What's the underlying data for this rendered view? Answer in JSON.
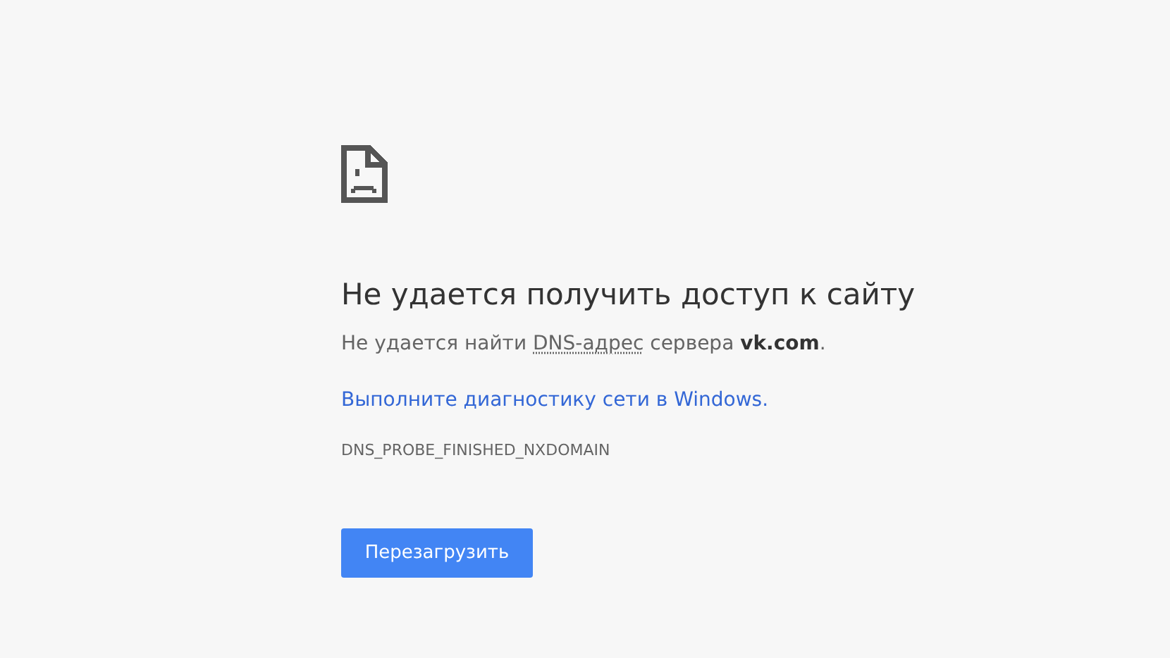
{
  "title": "Не удается получить доступ к сайту",
  "description": [
    {
      "kind": "text",
      "text": "Не удается найти "
    },
    {
      "kind": "abbr",
      "text": "DNS-адрес"
    },
    {
      "kind": "text",
      "text": " сервера "
    },
    {
      "kind": "bold",
      "text": "vk.com"
    },
    {
      "kind": "text",
      "text": "."
    }
  ],
  "suggestion_link": "Выполните диагностику сети в Windows.",
  "error_code": "DNS_PROBE_FINISHED_NXDOMAIN",
  "reload_button": "Перезагрузить"
}
